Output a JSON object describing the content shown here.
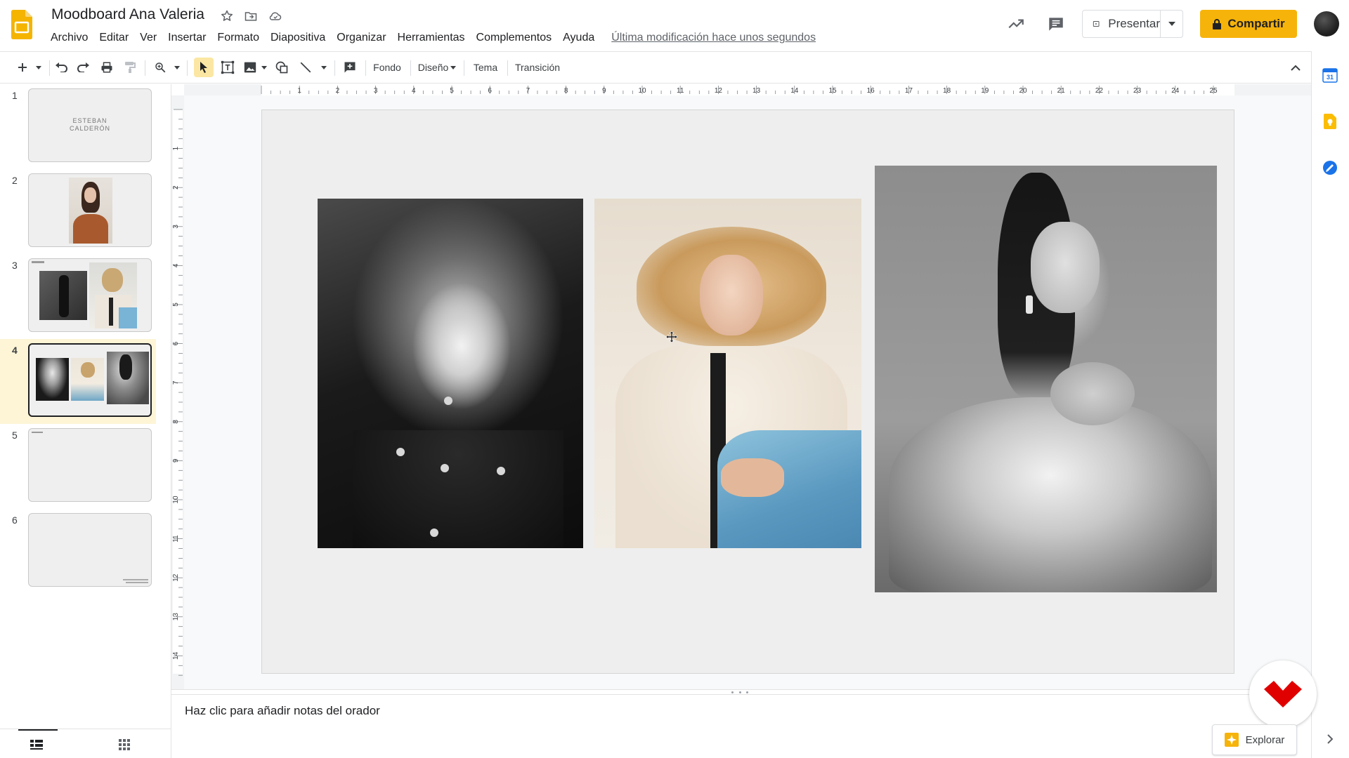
{
  "header": {
    "title": "Moodboard Ana Valeria",
    "menu": [
      "Archivo",
      "Editar",
      "Ver",
      "Insertar",
      "Formato",
      "Diapositiva",
      "Organizar",
      "Herramientas",
      "Complementos",
      "Ayuda"
    ],
    "last_edit": "Última modificación hace unos segundos",
    "present_label": "Presentar",
    "share_label": "Compartir"
  },
  "toolbar": {
    "fondo": "Fondo",
    "diseno": "Diseño",
    "tema": "Tema",
    "transicion": "Transición"
  },
  "ruler": {
    "horizontal": [
      "1",
      "2",
      "3",
      "4",
      "5",
      "6",
      "7",
      "8",
      "9",
      "10",
      "11",
      "12",
      "13",
      "14",
      "15",
      "16",
      "17",
      "18",
      "19",
      "20",
      "21",
      "22",
      "23",
      "24",
      "25"
    ],
    "vertical": [
      "1",
      "2",
      "3",
      "4",
      "5",
      "6",
      "7",
      "8",
      "9",
      "10",
      "11",
      "12",
      "13",
      "14"
    ]
  },
  "filmstrip": {
    "slides": [
      {
        "number": "1",
        "text_line1": "ESTEBAN",
        "text_line2": "CALDERÓN"
      },
      {
        "number": "2"
      },
      {
        "number": "3"
      },
      {
        "number": "4",
        "active": true
      },
      {
        "number": "5"
      },
      {
        "number": "6"
      }
    ]
  },
  "notes": {
    "placeholder": "Haz clic para añadir notas del orador"
  },
  "explore_label": "Explorar",
  "colors": {
    "share": "#f6b30a",
    "active_slide": "#fdf5d6",
    "calendar": "#1a73e8",
    "keep": "#fbbc04",
    "tasks": "#1a73e8",
    "brand_red": "#e00000"
  },
  "icons": [
    "slides-logo-icon",
    "star-icon",
    "move-folder-icon",
    "cloud-saved-icon",
    "activity-trend-icon",
    "comment-icon",
    "present-icon",
    "lock-icon",
    "calendar-icon",
    "keep-icon",
    "tasks-icon"
  ]
}
